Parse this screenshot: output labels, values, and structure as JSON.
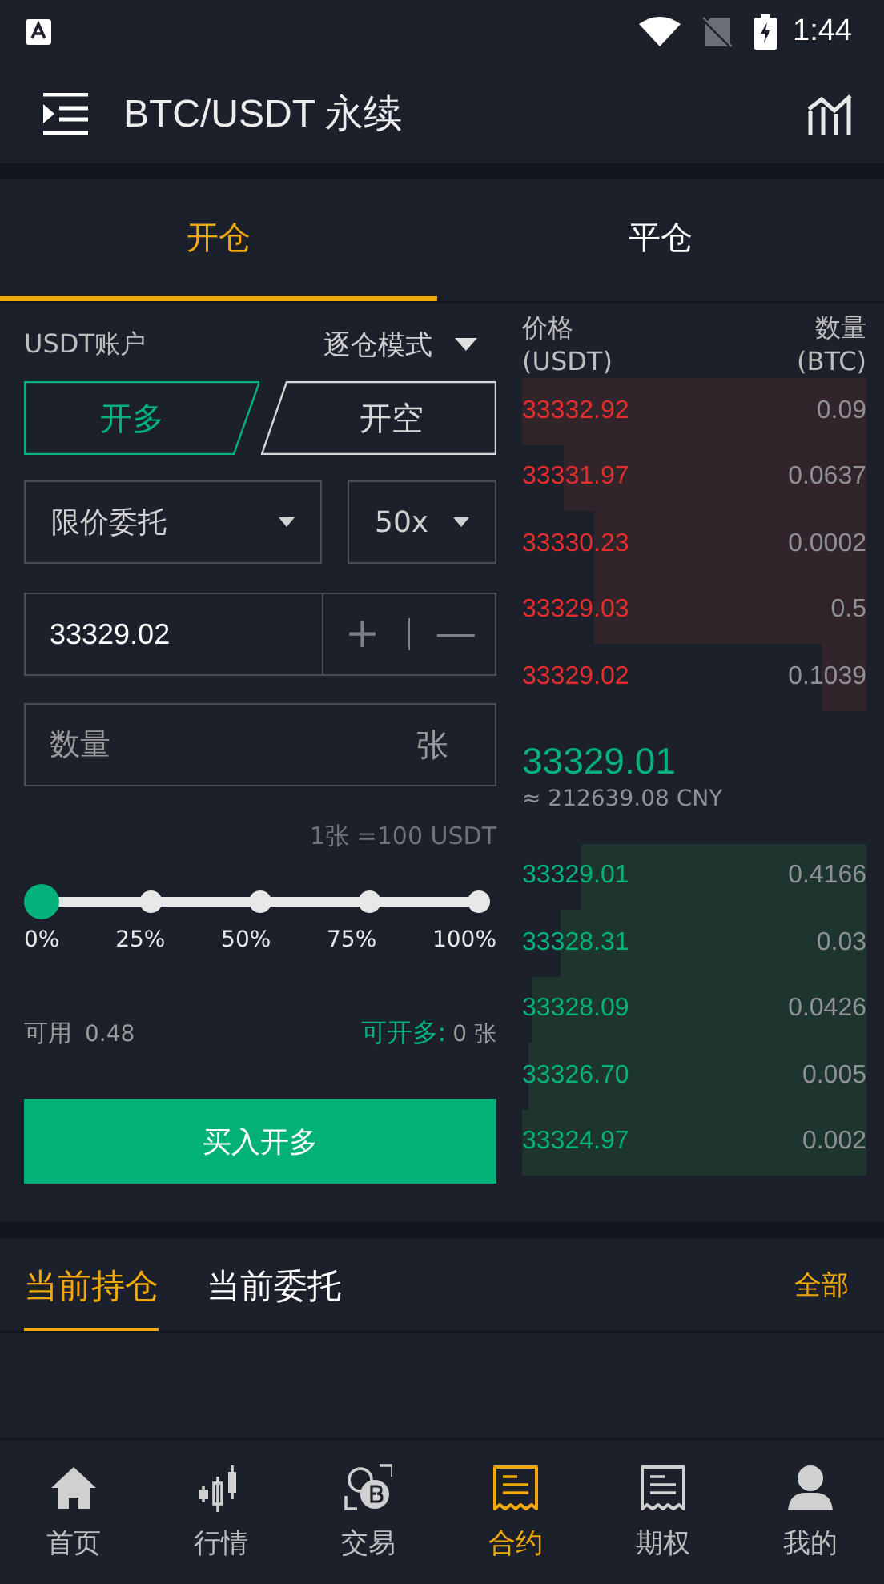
{
  "status_bar": {
    "time": "1:44"
  },
  "header": {
    "title": "BTC/USDT 永续"
  },
  "tabs": [
    {
      "label": "开仓",
      "selected": true
    },
    {
      "label": "平仓",
      "selected": false
    }
  ],
  "form": {
    "account": "USDT账户",
    "margin_mode": "逐仓模式",
    "sides": [
      {
        "label": "开多",
        "selected": true
      },
      {
        "label": "开空",
        "selected": false
      }
    ],
    "order_type": "限价委托",
    "leverage": "50x",
    "price": "33329.02",
    "plus": "+",
    "minus": "—",
    "quantity": {
      "placeholder": "数量",
      "unit": "张"
    },
    "unit_note": "1张 =100 USDT",
    "slider": {
      "level": 0,
      "ticks": [
        "0%",
        "25%",
        "50%",
        "75%",
        "100%"
      ]
    },
    "available_label": "可用",
    "available_value": "0.48",
    "max_label": "可开多:",
    "max_value": "0 张",
    "submit": "买入开多"
  },
  "order_book": {
    "price_header": "价格\n(USDT)",
    "amount_header": "数量\n(BTC)",
    "asks": [
      {
        "price": "33332.92",
        "amount": "0.09"
      },
      {
        "price": "33331.97",
        "amount": "0.0637"
      },
      {
        "price": "33330.23",
        "amount": "0.0002"
      },
      {
        "price": "33329.03",
        "amount": "0.5"
      },
      {
        "price": "33329.02",
        "amount": "0.1039"
      }
    ],
    "last_price": "33329.01",
    "cny_price": "≈ 212639.08 CNY",
    "bids": [
      {
        "price": "33329.01",
        "amount": "0.4166"
      },
      {
        "price": "33328.31",
        "amount": "0.03"
      },
      {
        "price": "33328.09",
        "amount": "0.0426"
      },
      {
        "price": "33326.70",
        "amount": "0.005"
      },
      {
        "price": "33324.97",
        "amount": "0.002"
      }
    ]
  },
  "positions": {
    "tabs": [
      {
        "label": "当前持仓",
        "selected": true
      },
      {
        "label": "当前委托",
        "selected": false
      }
    ],
    "all_link": "全部"
  },
  "bottom_nav": [
    {
      "label": "首页",
      "selected": false
    },
    {
      "label": "行情",
      "selected": false
    },
    {
      "label": "交易",
      "selected": false
    },
    {
      "label": "合约",
      "selected": true
    },
    {
      "label": "期权",
      "selected": false
    },
    {
      "label": "我的",
      "selected": false
    }
  ]
}
